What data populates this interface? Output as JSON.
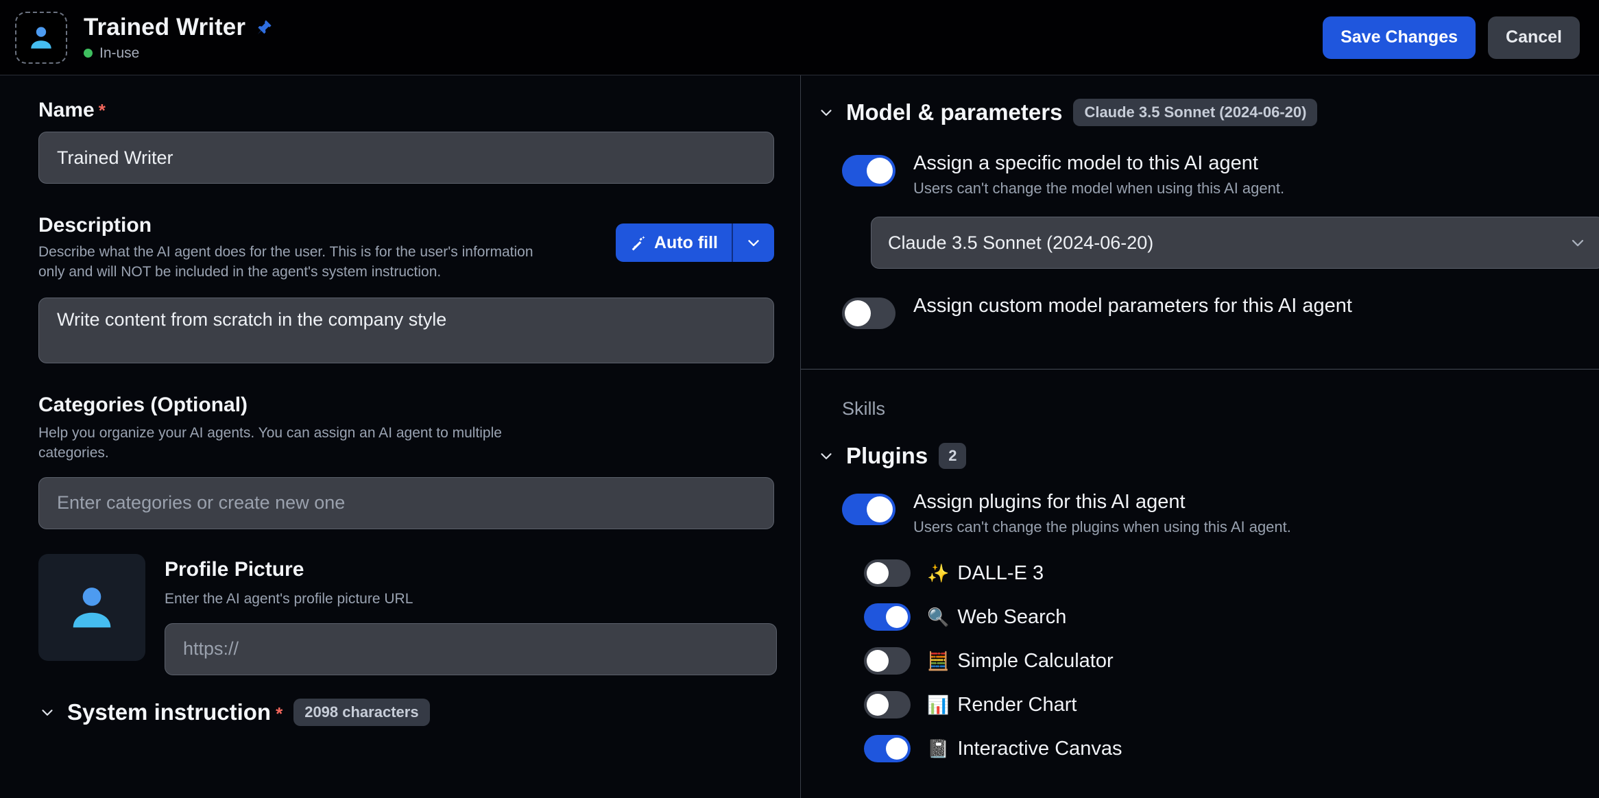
{
  "header": {
    "avatar_icon": "person-avatar-icon",
    "title": "Trained Writer",
    "pin_icon": "pushpin-icon",
    "status": "In-use",
    "status_color": "#3fbf5f",
    "save_label": "Save Changes",
    "cancel_label": "Cancel",
    "accent_color": "#1f56dd"
  },
  "left": {
    "name": {
      "label": "Name",
      "required_mark": "*",
      "value": "Trained Writer"
    },
    "description": {
      "label": "Description",
      "helper": "Describe what the AI agent does for the user. This is for the user's information only and will NOT be included in the agent's system instruction.",
      "autofill_label": "Auto fill",
      "autofill_icon": "magic-wand-icon",
      "autofill_caret_icon": "chevron-down-icon",
      "value": "Write content from scratch in the company style"
    },
    "categories": {
      "label": "Categories (Optional)",
      "helper": "Help you organize your AI agents. You can assign an AI agent to multiple categories.",
      "placeholder": "Enter categories or create new one",
      "value": ""
    },
    "profile_picture": {
      "label": "Profile Picture",
      "helper": "Enter the AI agent's profile picture URL",
      "placeholder": "https://",
      "value": "",
      "thumb_icon": "person-avatar-icon"
    },
    "system_instruction": {
      "chevron_icon": "chevron-down-icon",
      "label": "System instruction",
      "required_mark": "*",
      "char_badge": "2098 characters"
    }
  },
  "right": {
    "model_section": {
      "chevron_icon": "chevron-down-icon",
      "title": "Model & parameters",
      "badge": "Claude 3.5 Sonnet (2024-06-20)",
      "assign_model": {
        "title": "Assign a specific model to this AI agent",
        "sub": "Users can't change the model when using this AI agent.",
        "enabled": true
      },
      "model_select": {
        "value": "Claude 3.5 Sonnet (2024-06-20)",
        "caret_icon": "chevron-down-icon"
      },
      "assign_params": {
        "title": "Assign custom model parameters for this AI agent",
        "enabled": false
      }
    },
    "skills_label": "Skills",
    "plugins_section": {
      "chevron_icon": "chevron-down-icon",
      "title": "Plugins",
      "count": "2",
      "assign_plugins": {
        "title": "Assign plugins for this AI agent",
        "sub": "Users can't change the plugins when using this AI agent.",
        "enabled": true
      },
      "items": [
        {
          "emoji": "✨",
          "icon_name": "sparkles-icon",
          "label": "DALL-E 3",
          "enabled": false
        },
        {
          "emoji": "🔍",
          "icon_name": "magnifying-glass-icon",
          "label": "Web Search",
          "enabled": true
        },
        {
          "emoji": "🧮",
          "icon_name": "abacus-icon",
          "label": "Simple Calculator",
          "enabled": false
        },
        {
          "emoji": "📊",
          "icon_name": "bar-chart-icon",
          "label": "Render Chart",
          "enabled": false
        },
        {
          "emoji": "📓",
          "icon_name": "notebook-icon",
          "label": "Interactive Canvas",
          "enabled": true
        }
      ]
    }
  }
}
